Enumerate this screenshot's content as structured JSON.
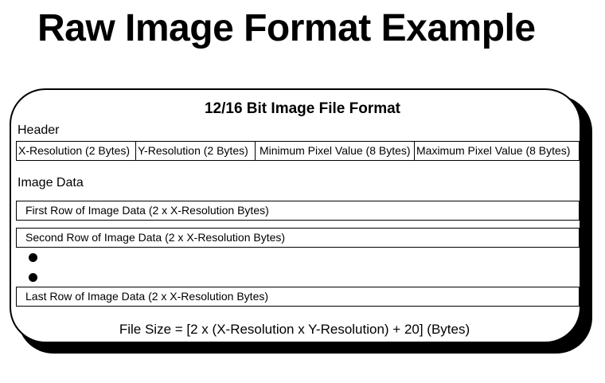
{
  "title": "Raw Image Format Example",
  "panel": {
    "title": "12/16 Bit Image File Format",
    "header_label": "Header",
    "header_fields": [
      "X-Resolution (2 Bytes)",
      "Y-Resolution (2 Bytes)",
      "Minimum Pixel Value (8 Bytes)",
      "Maximum Pixel Value (8 Bytes)"
    ],
    "image_data_label": "Image Data",
    "rows": {
      "first": "First Row of Image Data (2 x X-Resolution Bytes)",
      "second": "Second Row of Image Data (2 x X-Resolution Bytes)",
      "last": "Last Row of Image Data (2 x X-Resolution Bytes)"
    },
    "formula": "File Size = [2 x (X-Resolution x Y-Resolution) + 20] (Bytes)"
  }
}
